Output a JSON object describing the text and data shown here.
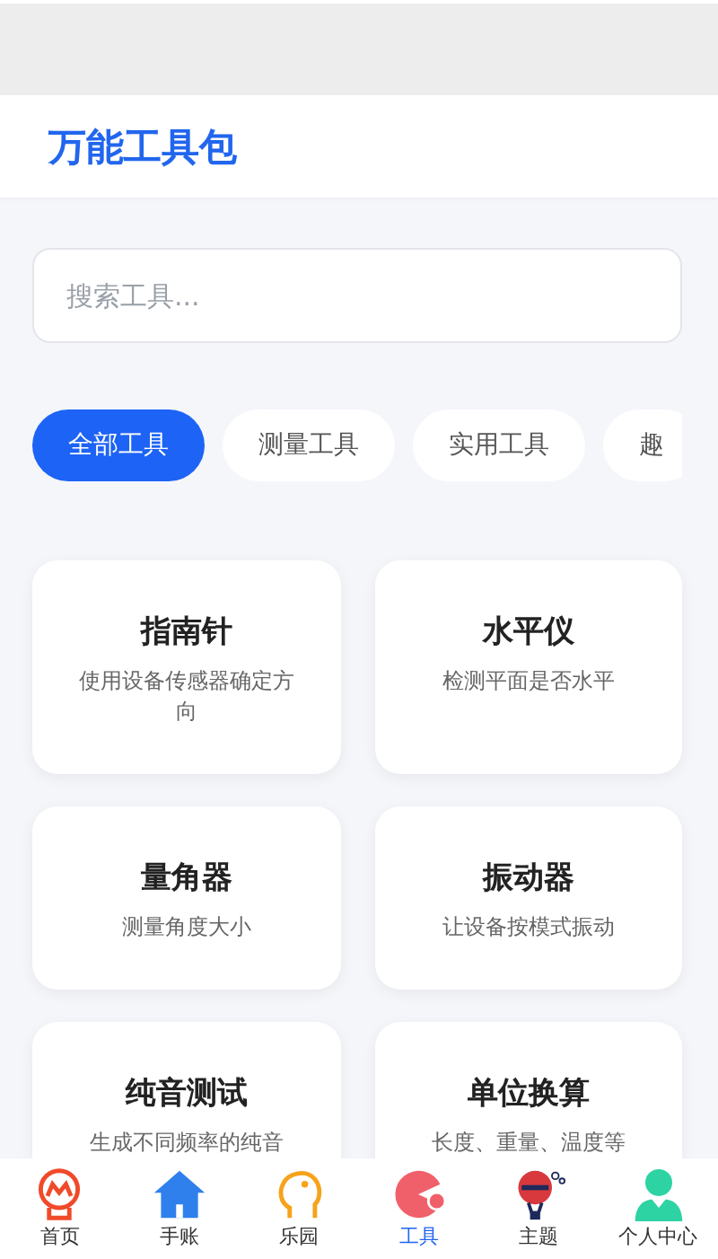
{
  "header": {
    "title": "万能工具包"
  },
  "search": {
    "placeholder": "搜索工具..."
  },
  "chips": [
    {
      "label": "全部工具",
      "selected": true
    },
    {
      "label": "测量工具",
      "selected": false
    },
    {
      "label": "实用工具",
      "selected": false
    },
    {
      "label": "趣",
      "selected": false
    }
  ],
  "tools": [
    {
      "name": "指南针",
      "description": "使用设备传感器确定方向"
    },
    {
      "name": "水平仪",
      "description": "检测平面是否水平"
    },
    {
      "name": "量角器",
      "description": "测量角度大小"
    },
    {
      "name": "振动器",
      "description": "让设备按模式振动"
    },
    {
      "name": "纯音测试",
      "description": "生成不同频率的纯音"
    },
    {
      "name": "单位换算",
      "description": "长度、重量、温度等"
    }
  ],
  "tab_bar": [
    {
      "kind": "badge",
      "label": "首页",
      "selected": false
    },
    {
      "kind": "house",
      "label": "手账",
      "selected": false
    },
    {
      "kind": "head",
      "label": "乐园",
      "selected": false
    },
    {
      "kind": "pacman",
      "label": "工具",
      "selected": true
    },
    {
      "kind": "balloon",
      "label": "主题",
      "selected": false
    },
    {
      "kind": "person",
      "label": "个人中心",
      "selected": false
    }
  ]
}
